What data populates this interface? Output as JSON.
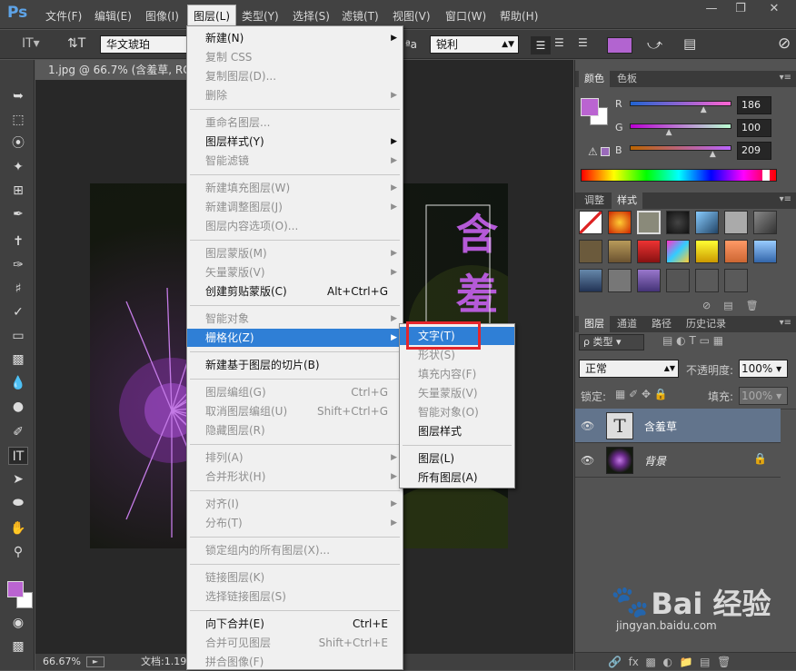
{
  "app": {
    "logo_text": "Ps"
  },
  "menubar": {
    "items": [
      "文件(F)",
      "编辑(E)",
      "图像(I)",
      "图层(L)",
      "类型(Y)",
      "选择(S)",
      "滤镜(T)",
      "视图(V)",
      "窗口(W)",
      "帮助(H)"
    ]
  },
  "options": {
    "font_family": "华文琥珀",
    "aa_label": "ªa",
    "antialias": "锐利",
    "text_color": "#b264d0"
  },
  "document": {
    "tab_title": "1.jpg @ 66.7% (含羞草, RGB",
    "zoom": "66.67%",
    "doc_info": "文档:1.19",
    "text_content": "含羞草"
  },
  "color_panel": {
    "tabs": [
      "颜色",
      "色板"
    ],
    "channels": [
      {
        "label": "R",
        "value": "186",
        "fraction": 0.73
      },
      {
        "label": "G",
        "value": "100",
        "fraction": 0.39
      },
      {
        "label": "B",
        "value": "209",
        "fraction": 0.82
      }
    ],
    "foreground": "#ba64d1",
    "background": "#ffffff"
  },
  "styles_panel": {
    "tabs": [
      "调整",
      "样式"
    ]
  },
  "layers_panel": {
    "tabs": [
      "图层",
      "通道",
      "路径",
      "历史记录"
    ],
    "filter": "ρ 类型",
    "blend_mode": "正常",
    "opacity_label": "不透明度:",
    "opacity": "100%",
    "lock_label": "锁定:",
    "fill_label": "填充:",
    "fill": "100%",
    "layers": [
      {
        "name": "含羞草",
        "thumb": "T",
        "selected": true
      },
      {
        "name": "背景",
        "selected": false
      }
    ]
  },
  "layer_menu": {
    "items": [
      {
        "label": "新建(N)",
        "arrow": true
      },
      {
        "label": "复制 CSS",
        "disabled": true
      },
      {
        "label": "复制图层(D)...",
        "disabled": true
      },
      {
        "label": "删除",
        "disabled": true,
        "arrow": true
      },
      {
        "sep": true
      },
      {
        "label": "重命名图层...",
        "disabled": true
      },
      {
        "label": "图层样式(Y)",
        "arrow": true
      },
      {
        "label": "智能滤镜",
        "disabled": true,
        "arrow": true
      },
      {
        "sep": true
      },
      {
        "label": "新建填充图层(W)",
        "disabled": true,
        "arrow": true
      },
      {
        "label": "新建调整图层(J)",
        "disabled": true,
        "arrow": true
      },
      {
        "label": "图层内容选项(O)...",
        "disabled": true
      },
      {
        "sep": true
      },
      {
        "label": "图层蒙版(M)",
        "disabled": true,
        "arrow": true
      },
      {
        "label": "矢量蒙版(V)",
        "disabled": true,
        "arrow": true
      },
      {
        "label": "创建剪贴蒙版(C)",
        "shortcut": "Alt+Ctrl+G"
      },
      {
        "sep": true
      },
      {
        "label": "智能对象",
        "disabled": true,
        "arrow": true
      },
      {
        "label": "栅格化(Z)",
        "highlighted": true,
        "arrow": true
      },
      {
        "sep": true
      },
      {
        "label": "新建基于图层的切片(B)"
      },
      {
        "sep": true
      },
      {
        "label": "图层编组(G)",
        "disabled": true,
        "shortcut": "Ctrl+G"
      },
      {
        "label": "取消图层编组(U)",
        "disabled": true,
        "shortcut": "Shift+Ctrl+G"
      },
      {
        "label": "隐藏图层(R)",
        "disabled": true
      },
      {
        "sep": true
      },
      {
        "label": "排列(A)",
        "disabled": true,
        "arrow": true
      },
      {
        "label": "合并形状(H)",
        "disabled": true,
        "arrow": true
      },
      {
        "sep": true
      },
      {
        "label": "对齐(I)",
        "disabled": true,
        "arrow": true
      },
      {
        "label": "分布(T)",
        "disabled": true,
        "arrow": true
      },
      {
        "sep": true
      },
      {
        "label": "锁定组内的所有图层(X)...",
        "disabled": true
      },
      {
        "sep": true
      },
      {
        "label": "链接图层(K)",
        "disabled": true
      },
      {
        "label": "选择链接图层(S)",
        "disabled": true
      },
      {
        "sep": true
      },
      {
        "label": "向下合并(E)",
        "shortcut": "Ctrl+E"
      },
      {
        "label": "合并可见图层",
        "disabled": true,
        "shortcut": "Shift+Ctrl+E"
      },
      {
        "label": "拼合图像(F)",
        "disabled": true
      }
    ]
  },
  "rasterize_menu": {
    "items": [
      {
        "label": "文字(T)",
        "highlighted": true
      },
      {
        "label": "形状(S)",
        "disabled": true
      },
      {
        "label": "填充内容(F)",
        "disabled": true
      },
      {
        "label": "矢量蒙版(V)",
        "disabled": true
      },
      {
        "label": "智能对象(O)",
        "disabled": true
      },
      {
        "label": "图层样式"
      },
      {
        "sep": true
      },
      {
        "label": "图层(L)"
      },
      {
        "label": "所有图层(A)"
      }
    ]
  },
  "watermark": {
    "text": "Bai 经验",
    "sub": "jingyan.baidu.com"
  }
}
